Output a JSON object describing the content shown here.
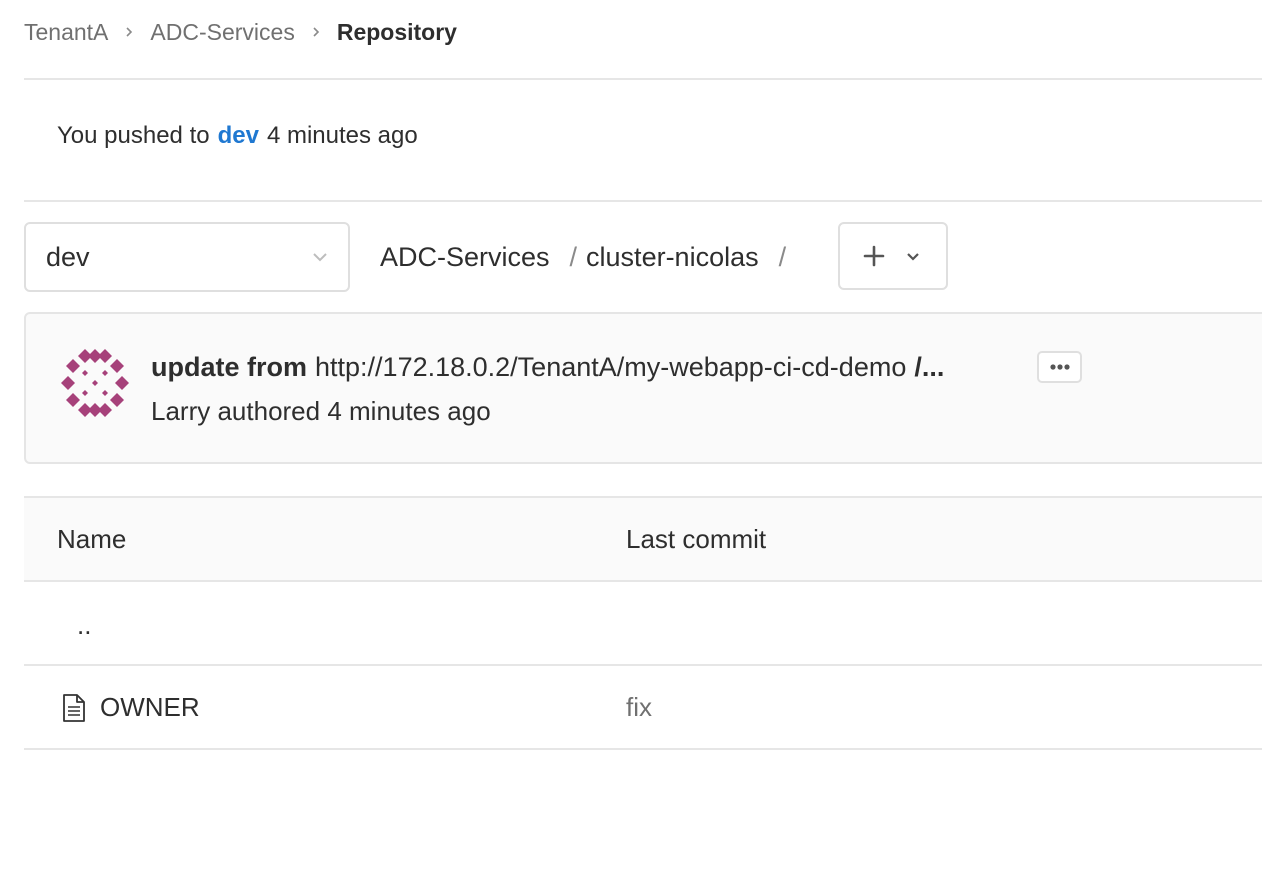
{
  "breadcrumb": {
    "items": [
      "TenantA",
      "ADC-Services"
    ],
    "current": "Repository"
  },
  "push_notice": {
    "prefix": "You pushed to",
    "branch": "dev",
    "time": "4 minutes ago"
  },
  "branch_selector": {
    "value": "dev"
  },
  "path": {
    "segments": [
      "ADC-Services",
      "cluster-nicolas"
    ],
    "separator": "/"
  },
  "last_commit": {
    "title_bold": "update from",
    "title_rest": "http://172.18.0.2/TenantA/my-webapp-ci-cd-demo",
    "title_truncated": "/...",
    "meta": "Larry authored 4 minutes ago"
  },
  "table": {
    "columns": [
      "Name",
      "Last commit"
    ],
    "parent_row": "..",
    "rows": [
      {
        "name": "OWNER",
        "last_commit": "fix",
        "icon": "file-text-icon"
      }
    ]
  },
  "colors": {
    "link": "#1f78d1",
    "avatar": "#a6417a",
    "muted": "#707070"
  }
}
